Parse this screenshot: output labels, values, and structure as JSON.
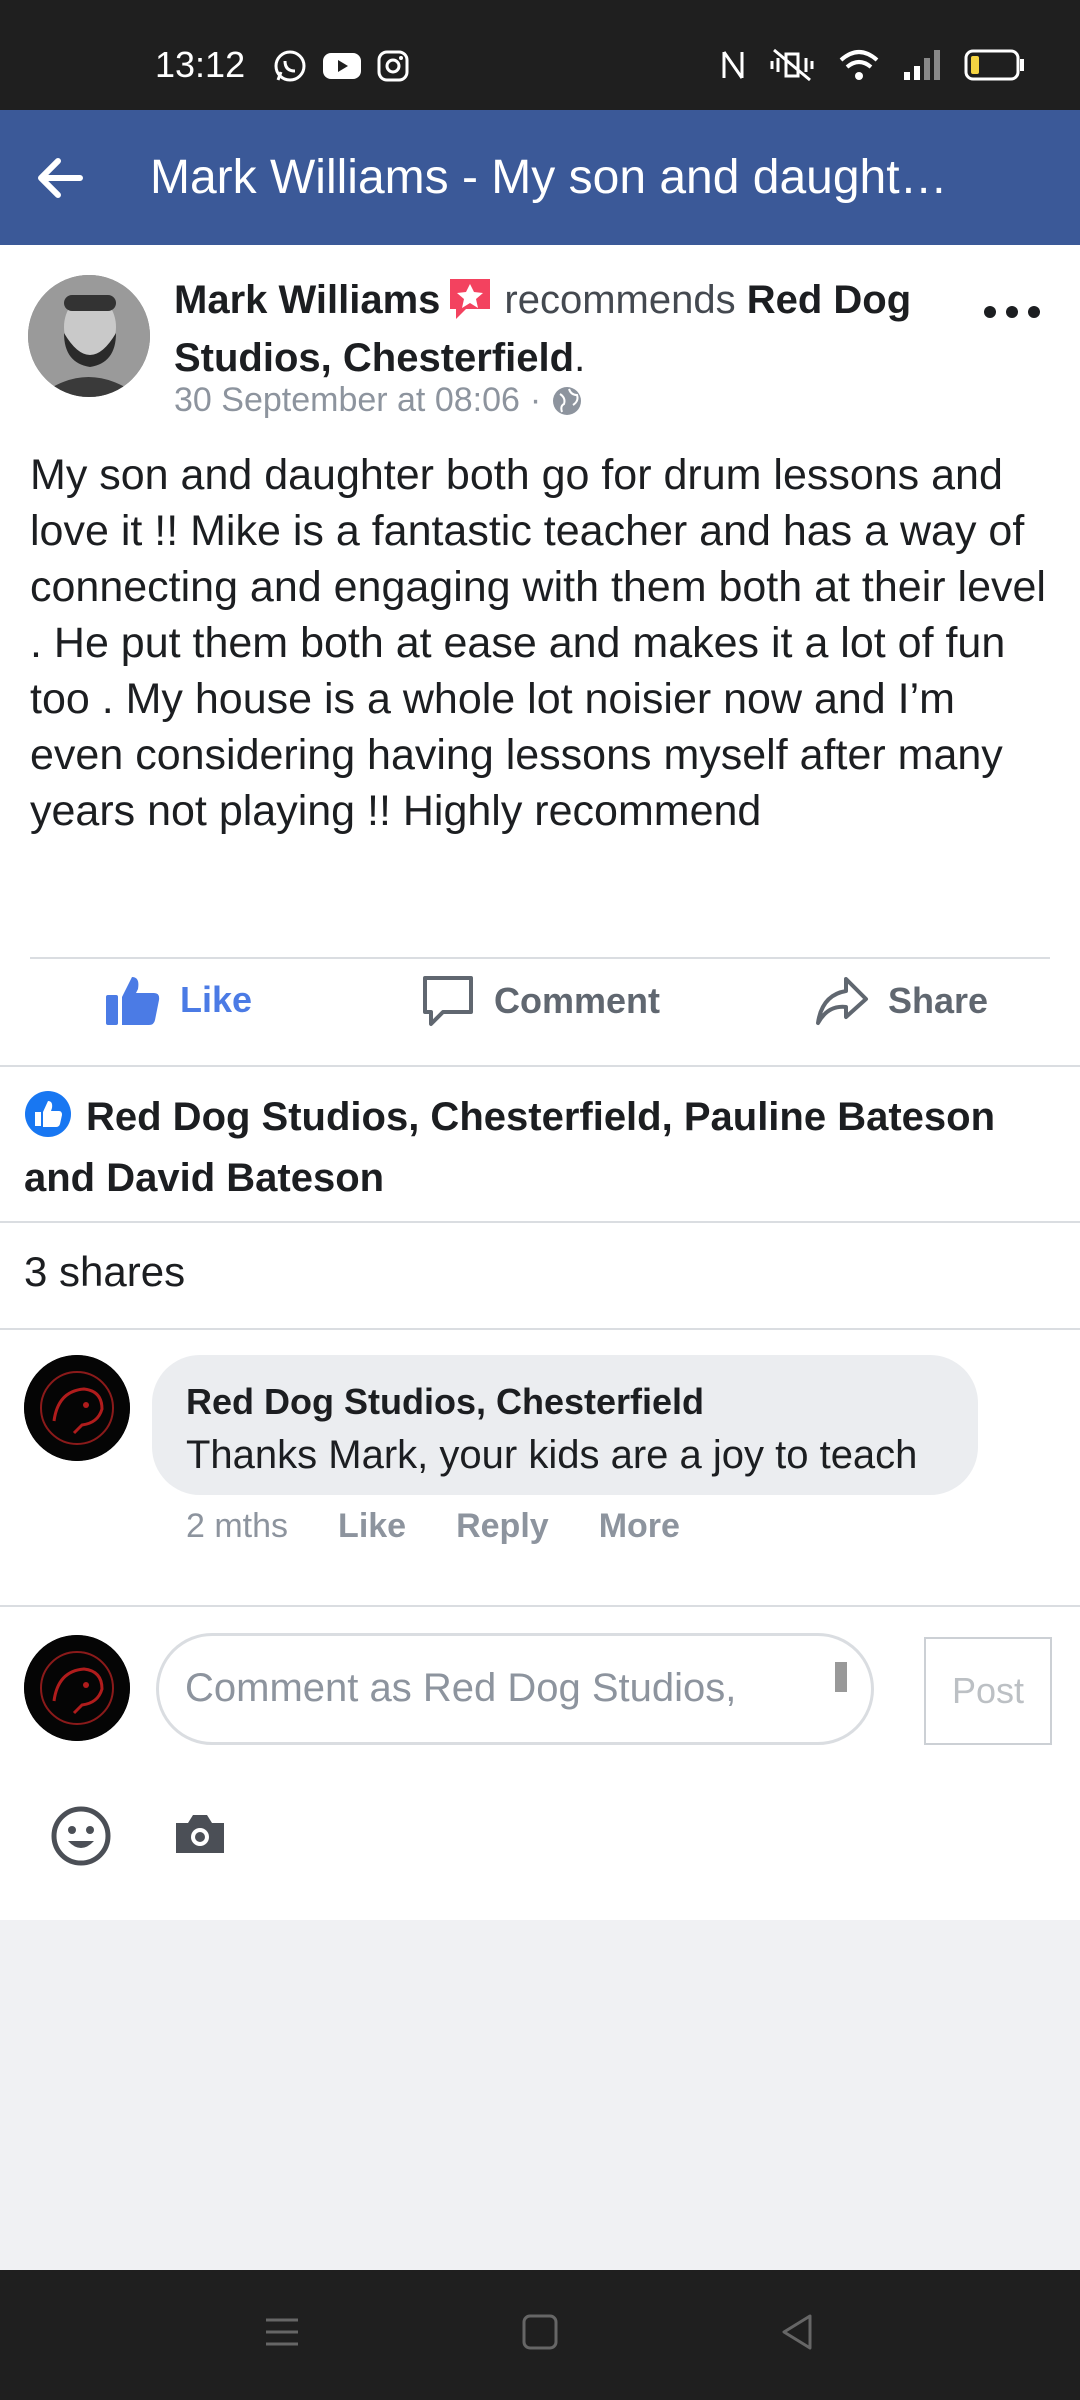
{
  "status_bar": {
    "time": "13:12",
    "app_icons": [
      "whatsapp-icon",
      "youtube-icon",
      "instagram-icon"
    ],
    "right_icons": [
      "nfc-icon",
      "vibrate-icon",
      "wifi-icon",
      "signal-icon",
      "battery-icon"
    ]
  },
  "header": {
    "title": "Mark Williams - My son and daughter both go for drum lessons and love it !! Mike is a fantastic teacher"
  },
  "post": {
    "author": "Mark Williams",
    "recommends_text": "recommends",
    "page_name": "Red Dog Studios, Chesterfield",
    "period": ".",
    "timestamp": "30 September at 08:06",
    "separator": "·",
    "body": "My son and daughter both go for drum lessons and love it !! Mike is a fantastic teacher and has a way of connecting and engaging with them both at their level . He put them both at ease and makes it a lot of fun too . My house is a whole lot noisier now and I’m even considering having lessons myself after many years not playing !! Highly recommend"
  },
  "actions": {
    "like": "Like",
    "comment": "Comment",
    "share": "Share"
  },
  "reactions": {
    "names": "Red Dog Studios, Chesterfield, Pauline Bateson and David Bateson"
  },
  "shares_label": "3 shares",
  "comment": {
    "author": "Red Dog Studios, Chesterfield",
    "text": "Thanks Mark, your kids are a joy to teach",
    "age": "2 mths",
    "like": "Like",
    "reply": "Reply",
    "more": "More"
  },
  "composer": {
    "placeholder": "Comment as Red Dog Studios,",
    "post_label": "Post"
  },
  "colors": {
    "facebook_blue": "#3b5998",
    "like_blue": "#4b7be5",
    "recommend_red": "#f3425f"
  }
}
